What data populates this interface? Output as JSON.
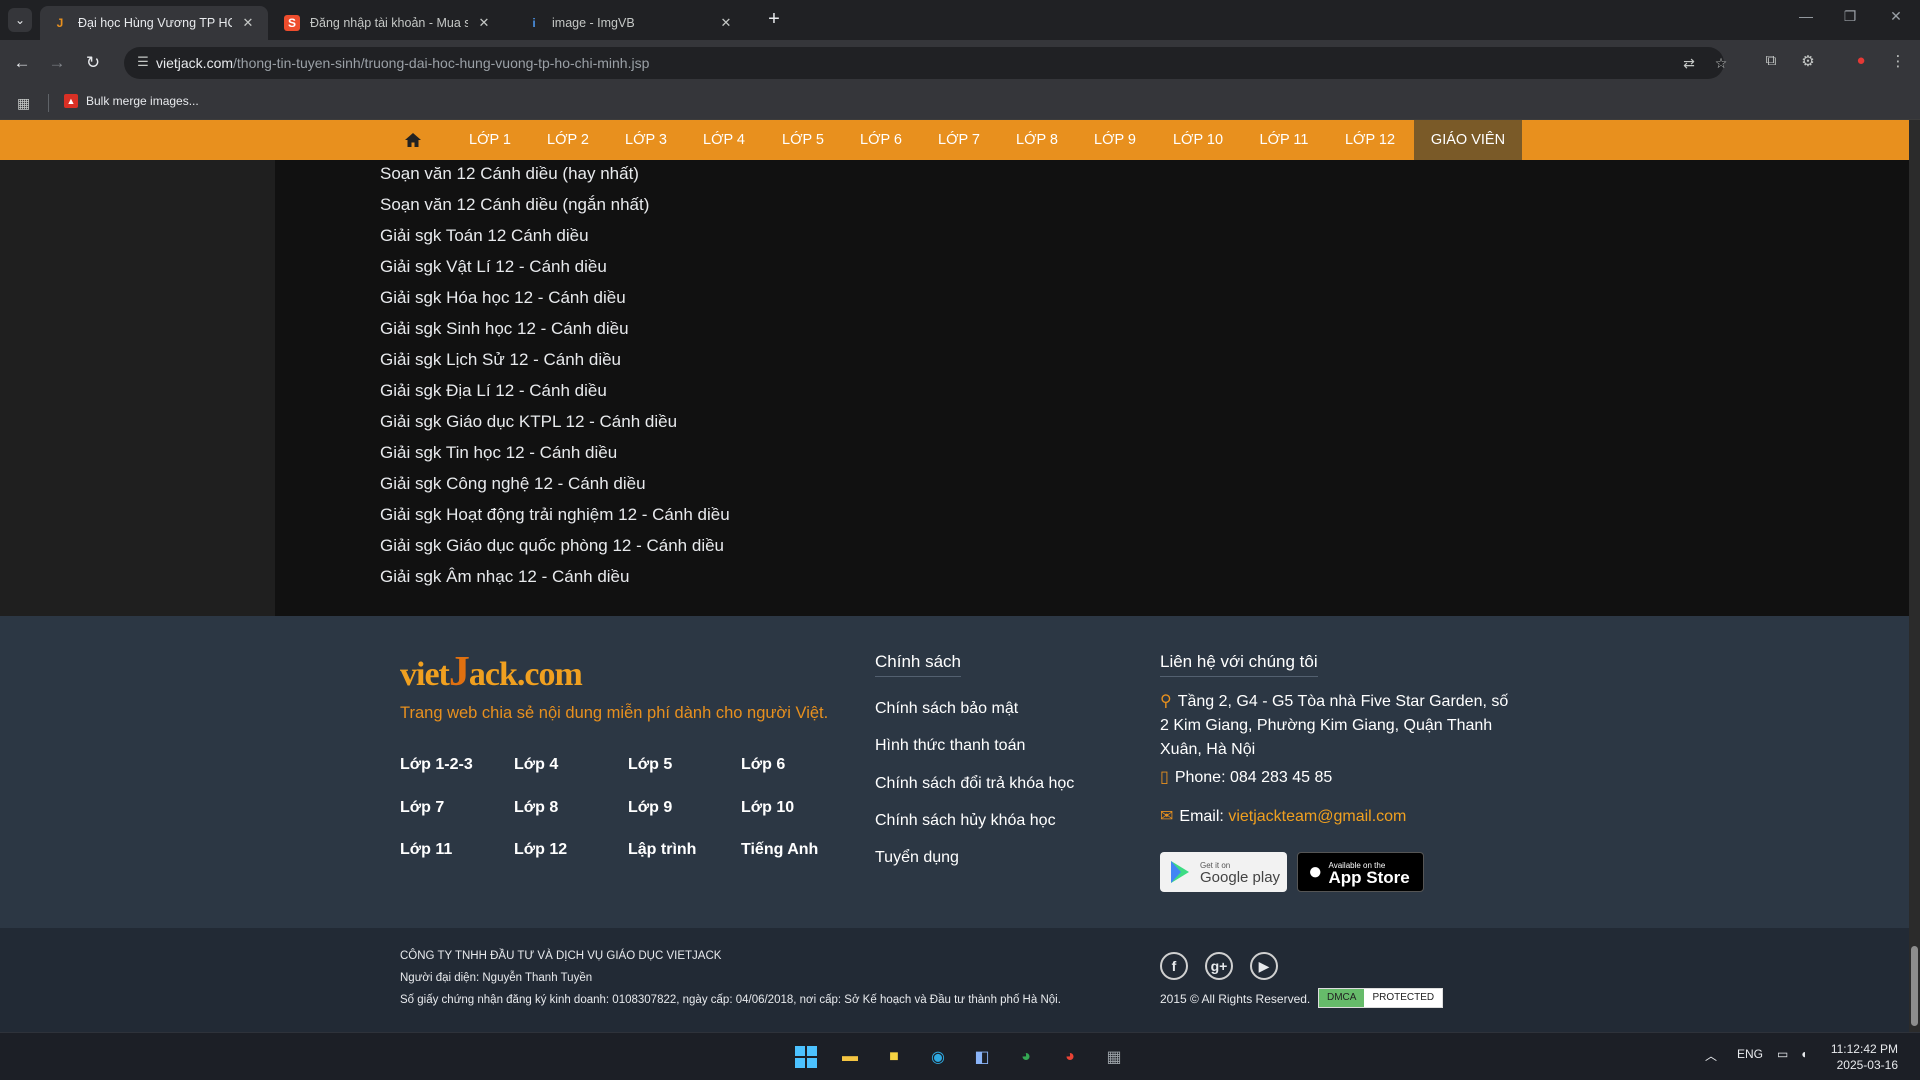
{
  "browser": {
    "tabs": [
      {
        "title": "Đại học Hùng Vương TP HCM (",
        "favicon": "J",
        "favicon_color": "#e8901e",
        "active": true
      },
      {
        "title": "Đăng nhập tài khoản - Mua sắm",
        "favicon": "S",
        "favicon_color": "#ee4d2d",
        "active": false
      },
      {
        "title": "image - ImgVB",
        "favicon": "i",
        "favicon_color": "#4a90e2",
        "active": false
      }
    ],
    "url_domain": "vietjack.com",
    "url_path": "/thong-tin-tuyen-sinh/truong-dai-hoc-hung-vuong-tp-ho-chi-minh.jsp",
    "bookmark": "Bulk merge images..."
  },
  "nav": {
    "items": [
      "LỚP 1",
      "LỚP 2",
      "LỚP 3",
      "LỚP 4",
      "LỚP 5",
      "LỚP 6",
      "LỚP 7",
      "LỚP 8",
      "LỚP 9",
      "LỚP 10",
      "LỚP 11",
      "LỚP 12"
    ],
    "teacher": "GIÁO VIÊN"
  },
  "content": {
    "links": [
      "Soạn văn 12 Cánh diều (hay nhất)",
      "Soạn văn 12 Cánh diều (ngắn nhất)",
      "Giải sgk Toán 12 Cánh diều",
      "Giải sgk Vật Lí 12 - Cánh diều",
      "Giải sgk Hóa học 12 - Cánh diều",
      "Giải sgk Sinh học 12 - Cánh diều",
      "Giải sgk Lịch Sử 12 - Cánh diều",
      "Giải sgk Địa Lí 12 - Cánh diều",
      "Giải sgk Giáo dục KTPL 12 - Cánh diều",
      "Giải sgk Tin học 12 - Cánh diều",
      "Giải sgk Công nghệ 12 - Cánh diều",
      "Giải sgk Hoạt động trải nghiệm 12 - Cánh diều",
      "Giải sgk Giáo dục quốc phòng 12 - Cánh diều",
      "Giải sgk Âm nhạc 12 - Cánh diều"
    ]
  },
  "footer": {
    "logo_a": "viet",
    "logo_b": "J",
    "logo_c": "ack.com",
    "slogan": "Trang web chia sẻ nội dung miễn phí dành cho người Việt.",
    "grades": [
      "Lớp 1-2-3",
      "Lớp 4",
      "Lớp 5",
      "Lớp 6",
      "Lớp 7",
      "Lớp 8",
      "Lớp 9",
      "Lớp 10",
      "Lớp 11",
      "Lớp 12",
      "Lập trình",
      "Tiếng Anh"
    ],
    "policy_title": "Chính sách",
    "policies": [
      "Chính sách bảo mật",
      "Hình thức thanh toán",
      "Chính sách đổi trả khóa học",
      "Chính sách hủy khóa học",
      "Tuyển dụng"
    ],
    "contact_title": "Liên hệ với chúng tôi",
    "address": "Tầng 2, G4 - G5 Tòa nhà Five Star Garden, số 2 Kim Giang, Phường Kim Giang, Quận Thanh Xuân, Hà Nội",
    "phone": "Phone: 084 283 45 85",
    "email_label": "Email: ",
    "email": "vietjackteam@gmail.com",
    "google_play_top": "Get it on",
    "google_play": "Google play",
    "app_store_top": "Available on the",
    "app_store": "App Store"
  },
  "bottom": {
    "company": "CÔNG TY TNHH ĐẦU TƯ VÀ DỊCH VỤ GIÁO DỤC VIETJACK",
    "rep": "Người đại diện: Nguyễn Thanh Tuyền",
    "license": "Số giấy chứng nhận đăng ký kinh doanh: 0108307822, ngày cấp: 04/06/2018, nơi cấp: Sở Kế hoạch và Đầu tư thành phố Hà Nội.",
    "copyright": "2015 © All Rights Reserved.",
    "dmca_a": "DMCA",
    "dmca_b": "PROTECTED"
  },
  "taskbar": {
    "lang": "ENG",
    "time": "11:12:42 PM",
    "date": "2025-03-16"
  },
  "colors": {
    "nav_orange": "#e8901e",
    "footer_bg": "#2c3744",
    "accent": "#f0a020"
  }
}
